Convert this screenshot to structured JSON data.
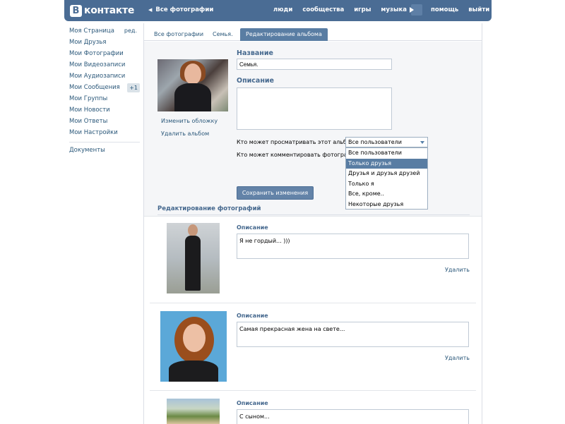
{
  "header": {
    "logo_letter": "В",
    "logo_text": "контакте",
    "back_link": "Все фотографии",
    "nav": [
      "люди",
      "сообщества",
      "игры",
      "музыка",
      "помощь",
      "выйти"
    ]
  },
  "sidebar": {
    "items": [
      {
        "label": "Моя Страница",
        "extra": "ред."
      },
      {
        "label": "Мои Друзья"
      },
      {
        "label": "Мои Фотографии"
      },
      {
        "label": "Мои Видеозаписи"
      },
      {
        "label": "Мои Аудиозаписи"
      },
      {
        "label": "Мои Сообщения",
        "badge": "+1"
      },
      {
        "label": "Мои Группы"
      },
      {
        "label": "Мои Новости"
      },
      {
        "label": "Мои Ответы"
      },
      {
        "label": "Мои Настройки"
      }
    ],
    "documents": "Документы"
  },
  "tabs": [
    "Все фотографии",
    "Семья.",
    "Редактирование альбома"
  ],
  "album": {
    "change_cover": "Изменить обложку",
    "delete_album": "Удалить альбом",
    "name_label": "Название",
    "name_value": "Семья.",
    "desc_label": "Описание",
    "desc_value": "",
    "view_label": "Кто может просматривать этот альбом?",
    "comment_label": "Кто может комментировать фотографии?",
    "select_value": "Все пользователи",
    "options": [
      "Все пользователи",
      "Только друзья",
      "Друзья и друзья друзей",
      "Только я",
      "Все, кроме..",
      "Некоторые друзья"
    ],
    "selected_index": 1,
    "save_button": "Сохранить изменения"
  },
  "photos": {
    "section_title": "Редактирование фотографий",
    "items": [
      {
        "label": "Описание",
        "text": "Я не гордый... )))",
        "delete": "Удалить"
      },
      {
        "label": "Описание",
        "text": "Самая прекрасная жена на свете...",
        "delete": "Удалить"
      },
      {
        "label": "Описание",
        "text": "С сыном..."
      }
    ]
  },
  "colors": {
    "header_bg": "#4a6c94",
    "link": "#2b587a",
    "accent": "#597da3"
  }
}
